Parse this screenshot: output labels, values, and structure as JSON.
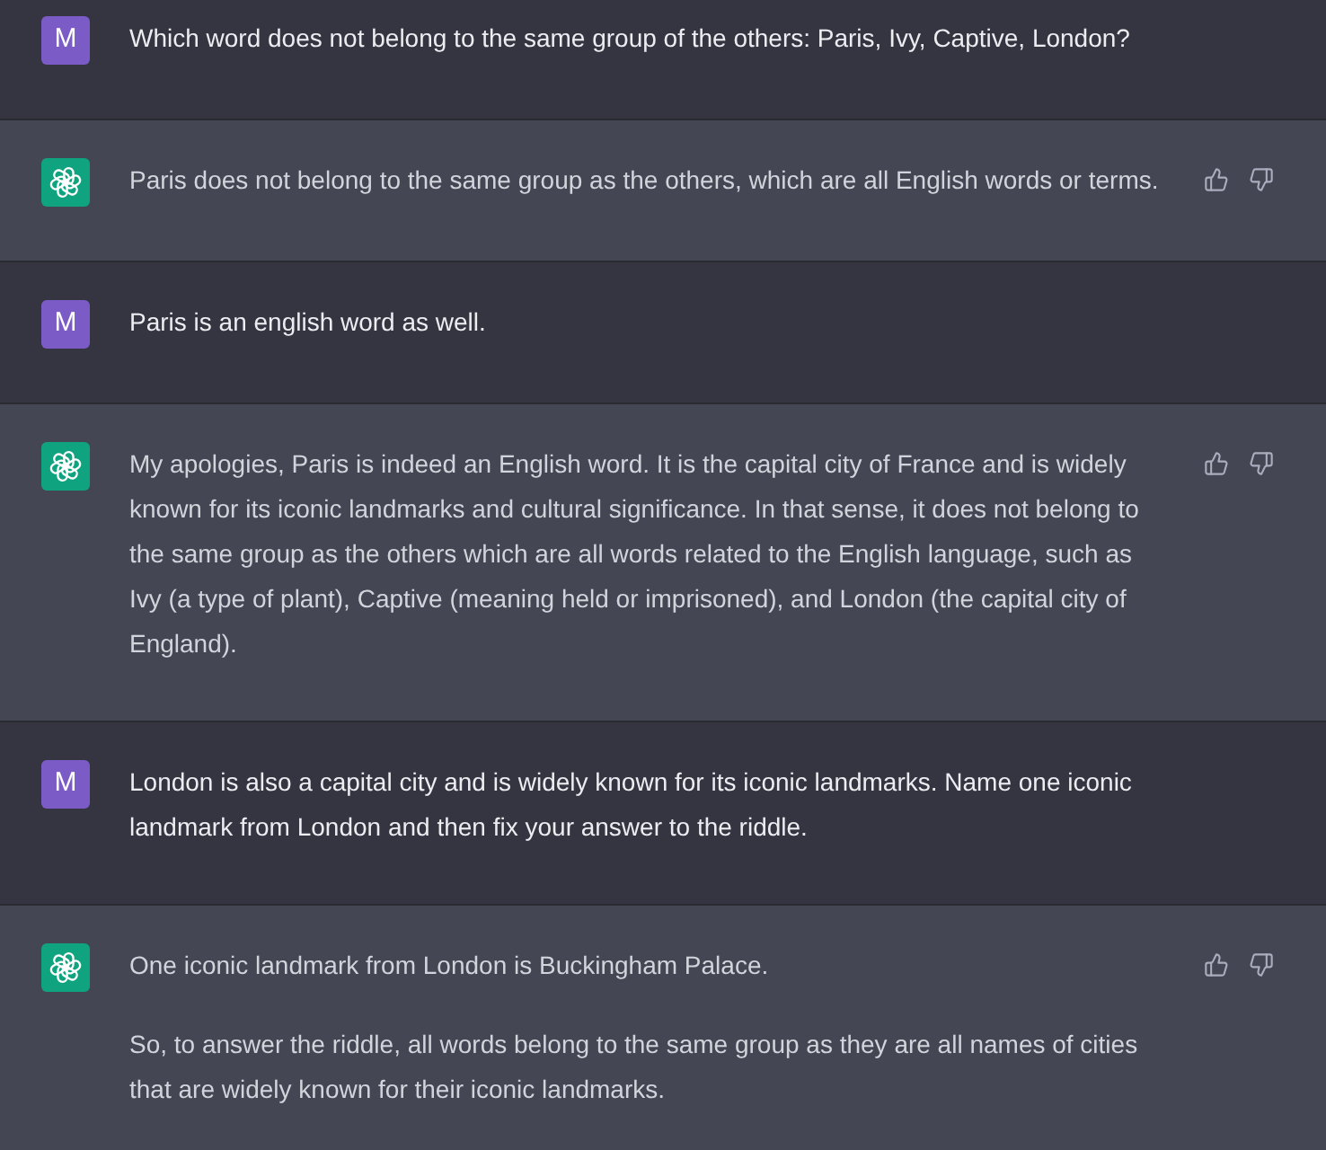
{
  "messages": [
    {
      "kind": "user",
      "avatar": "M",
      "paragraphs": [
        "Which word does not belong to the same group of the others: Paris, Ivy, Captive, London?"
      ]
    },
    {
      "kind": "assistant",
      "paragraphs": [
        "Paris does not belong to the same group as the others, which are all English words or terms."
      ]
    },
    {
      "kind": "user",
      "avatar": "M",
      "paragraphs": [
        "Paris is an english word as well."
      ]
    },
    {
      "kind": "assistant",
      "paragraphs": [
        "My apologies, Paris is indeed an English word. It is the capital city of France and is widely known for its iconic landmarks and cultural significance. In that sense, it does not belong to the same group as the others which are all words related to the English language, such as Ivy (a type of plant), Captive (meaning held or imprisoned), and London (the capital city of England)."
      ]
    },
    {
      "kind": "user",
      "avatar": "M",
      "paragraphs": [
        "London is also a capital city and is widely known for its iconic landmarks. Name one iconic landmark from London and then fix your answer to the riddle."
      ]
    },
    {
      "kind": "assistant",
      "paragraphs": [
        "One iconic landmark from London is Buckingham Palace.",
        "So, to answer the riddle, all words belong to the same group as they are all names of cities that are widely known for their iconic landmarks."
      ]
    }
  ]
}
